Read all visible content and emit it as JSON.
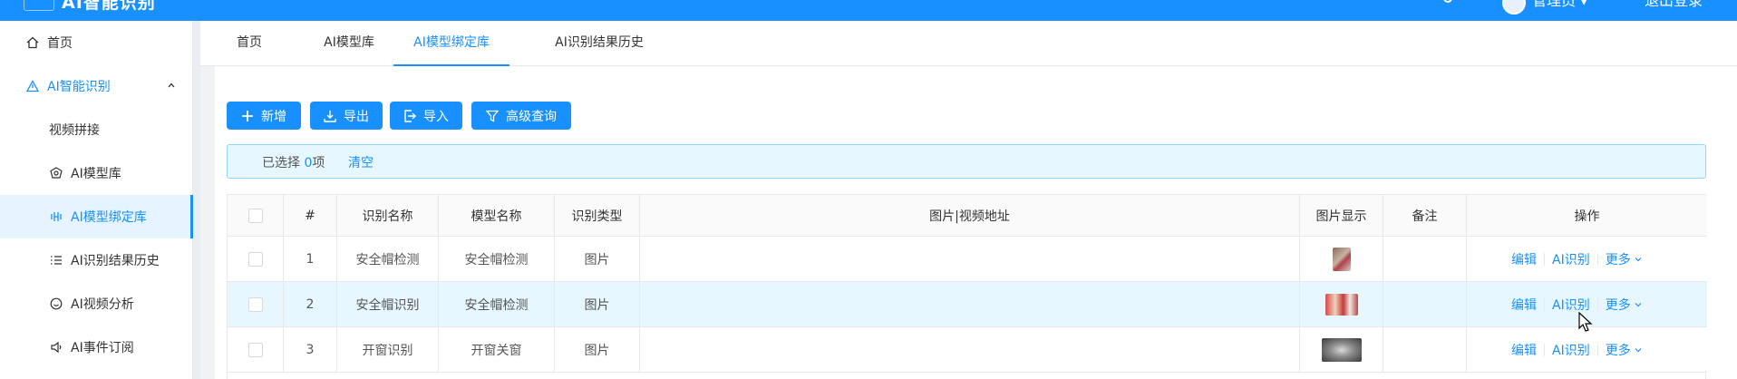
{
  "sidebar": {
    "items": [
      {
        "label": "首页",
        "icon": "home-icon"
      },
      {
        "label": "AI智能识别",
        "icon": "warning-triangle-icon"
      },
      {
        "label": "视频拼接",
        "icon": ""
      },
      {
        "label": "AI模型库",
        "icon": "model-box-icon"
      },
      {
        "label": "AI模型绑定库",
        "icon": "link-icon"
      },
      {
        "label": "AI识别结果历史",
        "icon": "list-icon"
      },
      {
        "label": "AI视频分析",
        "icon": "face-icon"
      },
      {
        "label": "AI事件订阅",
        "icon": "speaker-icon"
      }
    ]
  },
  "tabs": [
    {
      "label": "首页"
    },
    {
      "label": "AI模型库"
    },
    {
      "label": "AI模型绑定库"
    },
    {
      "label": "AI识别结果历史"
    }
  ],
  "toolbar": {
    "add_label": "新增",
    "export_label": "导出",
    "import_label": "导入",
    "advanced_label": "高级查询"
  },
  "selection": {
    "prefix": "已选择 ",
    "count": "0",
    "suffix": "项",
    "clear_label": "清空"
  },
  "table": {
    "columns": [
      "#",
      "识别名称",
      "模型名称",
      "识别类型",
      "图片|视频地址",
      "图片显示",
      "备注",
      "操作"
    ],
    "rows": [
      {
        "index": "1",
        "name": "安全帽检测",
        "model": "安全帽检测",
        "type": "图片",
        "url": "",
        "remark": ""
      },
      {
        "index": "2",
        "name": "安全帽识别",
        "model": "安全帽检测",
        "type": "图片",
        "url": "",
        "remark": ""
      },
      {
        "index": "3",
        "name": "开窗识别",
        "model": "开窗关窗",
        "type": "图片",
        "url": "",
        "remark": ""
      }
    ],
    "actions": {
      "edit": "编辑",
      "recognize": "AI识别",
      "more": "更多"
    }
  },
  "colors": {
    "primary": "#1890ff",
    "hover_row": "#e6f7ff"
  }
}
